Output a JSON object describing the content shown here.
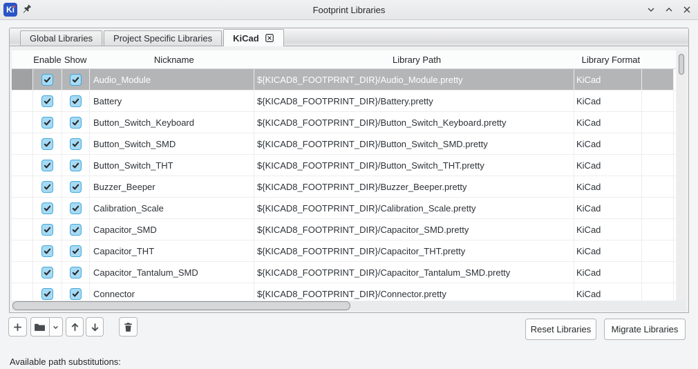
{
  "window": {
    "title": "Footprint Libraries",
    "logo_text": "Ki"
  },
  "tabs": [
    {
      "label": "Global Libraries",
      "active": false
    },
    {
      "label": "Project Specific Libraries",
      "active": false
    },
    {
      "label": "KiCad",
      "active": true,
      "closable": true
    }
  ],
  "table": {
    "columns": [
      "Enable",
      "Show",
      "Nickname",
      "Library Path",
      "Library Format"
    ],
    "rows": [
      {
        "enable": true,
        "show": true,
        "nickname": "Audio_Module",
        "path": "${KICAD8_FOOTPRINT_DIR}/Audio_Module.pretty",
        "format": "KiCad",
        "selected": true
      },
      {
        "enable": true,
        "show": true,
        "nickname": "Battery",
        "path": "${KICAD8_FOOTPRINT_DIR}/Battery.pretty",
        "format": "KiCad",
        "selected": false
      },
      {
        "enable": true,
        "show": true,
        "nickname": "Button_Switch_Keyboard",
        "path": "${KICAD8_FOOTPRINT_DIR}/Button_Switch_Keyboard.pretty",
        "format": "KiCad",
        "selected": false
      },
      {
        "enable": true,
        "show": true,
        "nickname": "Button_Switch_SMD",
        "path": "${KICAD8_FOOTPRINT_DIR}/Button_Switch_SMD.pretty",
        "format": "KiCad",
        "selected": false
      },
      {
        "enable": true,
        "show": true,
        "nickname": "Button_Switch_THT",
        "path": "${KICAD8_FOOTPRINT_DIR}/Button_Switch_THT.pretty",
        "format": "KiCad",
        "selected": false
      },
      {
        "enable": true,
        "show": true,
        "nickname": "Buzzer_Beeper",
        "path": "${KICAD8_FOOTPRINT_DIR}/Buzzer_Beeper.pretty",
        "format": "KiCad",
        "selected": false
      },
      {
        "enable": true,
        "show": true,
        "nickname": "Calibration_Scale",
        "path": "${KICAD8_FOOTPRINT_DIR}/Calibration_Scale.pretty",
        "format": "KiCad",
        "selected": false
      },
      {
        "enable": true,
        "show": true,
        "nickname": "Capacitor_SMD",
        "path": "${KICAD8_FOOTPRINT_DIR}/Capacitor_SMD.pretty",
        "format": "KiCad",
        "selected": false
      },
      {
        "enable": true,
        "show": true,
        "nickname": "Capacitor_THT",
        "path": "${KICAD8_FOOTPRINT_DIR}/Capacitor_THT.pretty",
        "format": "KiCad",
        "selected": false
      },
      {
        "enable": true,
        "show": true,
        "nickname": "Capacitor_Tantalum_SMD",
        "path": "${KICAD8_FOOTPRINT_DIR}/Capacitor_Tantalum_SMD.pretty",
        "format": "KiCad",
        "selected": false
      },
      {
        "enable": true,
        "show": true,
        "nickname": "Connector",
        "path": "${KICAD8_FOOTPRINT_DIR}/Connector.pretty",
        "format": "KiCad",
        "selected": false
      }
    ]
  },
  "toolbar_icons": [
    "add-icon",
    "folder-open-icon",
    "dropdown-chevron-icon",
    "move-up-icon",
    "move-down-icon",
    "delete-icon"
  ],
  "window_icons": [
    "shade-chevron-down-icon",
    "unshade-chevron-up-icon",
    "close-icon"
  ],
  "actions": {
    "reset_label": "Reset Libraries",
    "migrate_label": "Migrate Libraries"
  },
  "footer": {
    "path_substitutions_label": "Available path substitutions:"
  },
  "colors": {
    "accent_blue": "#3daee9",
    "checkbox_fill": "#a7daf3",
    "selection_gray": "#b4b5b7",
    "logo_blue": "#2a54c6",
    "logo_dot_red": "#f04e23"
  }
}
